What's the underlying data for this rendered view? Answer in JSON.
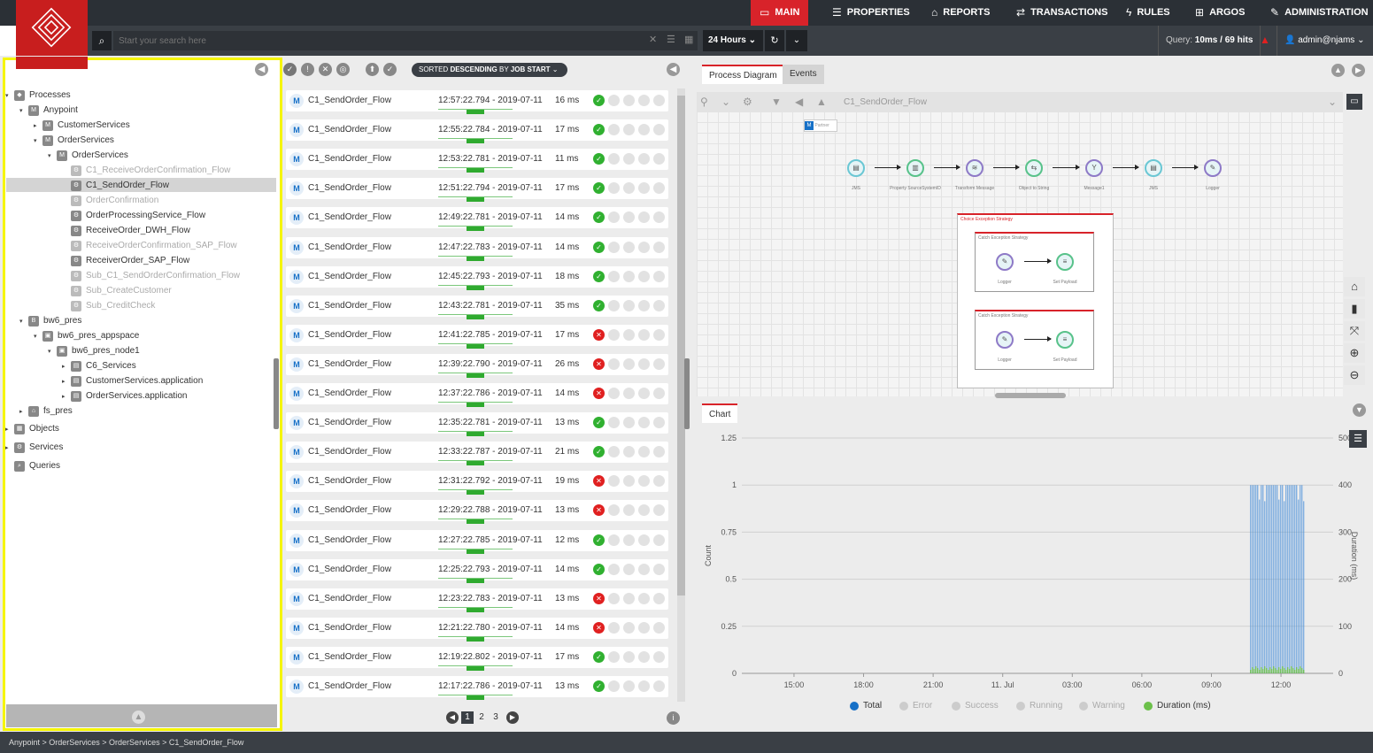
{
  "nav": {
    "items": [
      {
        "label": "MAIN",
        "icon": "dashboard-icon",
        "glyph": "▭"
      },
      {
        "label": "PROPERTIES",
        "icon": "list-icon",
        "glyph": "☰"
      },
      {
        "label": "REPORTS",
        "icon": "chart-icon",
        "glyph": "⌂"
      },
      {
        "label": "TRANSACTIONS",
        "icon": "exchange-icon",
        "glyph": "⇄"
      },
      {
        "label": "RULES",
        "icon": "bolt-icon",
        "glyph": "ϟ"
      },
      {
        "label": "ARGOS",
        "icon": "argos-icon",
        "glyph": "⊞"
      },
      {
        "label": "ADMINISTRATION",
        "icon": "wrench-icon",
        "glyph": "✎"
      }
    ],
    "active": "MAIN",
    "active_color": "#d8232a"
  },
  "search": {
    "placeholder": "Start your search here"
  },
  "time": {
    "range": "24 Hours"
  },
  "query": {
    "label": "Query:",
    "value": "10ms / 69 hits"
  },
  "user": {
    "name": "admin@njams"
  },
  "tree": [
    {
      "label": "Processes",
      "icon": "processes-icon"
    },
    {
      "label": "Anypoint",
      "icon": "mule-domain-icon"
    },
    {
      "label": "CustomerServices",
      "icon": "mule-app-icon"
    },
    {
      "label": "OrderServices",
      "icon": "mule-app-icon"
    },
    {
      "label": "OrderServices",
      "icon": "mule-app-icon"
    },
    {
      "label": "C1_ReceiveOrderConfirmation_Flow",
      "icon": "flow-icon"
    },
    {
      "label": "C1_SendOrder_Flow",
      "icon": "flow-icon"
    },
    {
      "label": "OrderConfirmation",
      "icon": "flow-icon"
    },
    {
      "label": "OrderProcessingService_Flow",
      "icon": "flow-icon"
    },
    {
      "label": "ReceiveOrder_DWH_Flow",
      "icon": "flow-icon"
    },
    {
      "label": "ReceiveOrderConfirmation_SAP_Flow",
      "icon": "flow-icon"
    },
    {
      "label": "ReceiverOrder_SAP_Flow",
      "icon": "flow-icon"
    },
    {
      "label": "Sub_C1_SendOrderConfirmation_Flow",
      "icon": "flow-icon"
    },
    {
      "label": "Sub_CreateCustomer",
      "icon": "flow-icon"
    },
    {
      "label": "Sub_CreditCheck",
      "icon": "flow-icon"
    },
    {
      "label": "bw6_pres",
      "icon": "bw-domain-icon"
    },
    {
      "label": "bw6_pres_appspace",
      "icon": "appspace-icon"
    },
    {
      "label": "bw6_pres_node1",
      "icon": "appnode-icon"
    },
    {
      "label": "C6_Services",
      "icon": "application-icon"
    },
    {
      "label": "CustomerServices.application",
      "icon": "application-icon"
    },
    {
      "label": "OrderServices.application",
      "icon": "application-icon"
    },
    {
      "label": "fs_pres",
      "icon": "home-icon"
    },
    {
      "label": "Objects",
      "icon": "objects-icon"
    },
    {
      "label": "Services",
      "icon": "services-icon"
    },
    {
      "label": "Queries",
      "icon": "search-icon"
    }
  ],
  "sort": {
    "prefix": "SORTED",
    "order": "DESCENDING",
    "by": "BY",
    "field": "JOB START"
  },
  "executions": [
    {
      "name": "C1_SendOrder_Flow",
      "time": "12:57:22.794 - 2019-07-11",
      "duration": "16 ms",
      "status": "success"
    },
    {
      "name": "C1_SendOrder_Flow",
      "time": "12:55:22.784 - 2019-07-11",
      "duration": "17 ms",
      "status": "success"
    },
    {
      "name": "C1_SendOrder_Flow",
      "time": "12:53:22.781 - 2019-07-11",
      "duration": "11 ms",
      "status": "success"
    },
    {
      "name": "C1_SendOrder_Flow",
      "time": "12:51:22.794 - 2019-07-11",
      "duration": "17 ms",
      "status": "success"
    },
    {
      "name": "C1_SendOrder_Flow",
      "time": "12:49:22.781 - 2019-07-11",
      "duration": "14 ms",
      "status": "success"
    },
    {
      "name": "C1_SendOrder_Flow",
      "time": "12:47:22.783 - 2019-07-11",
      "duration": "14 ms",
      "status": "success"
    },
    {
      "name": "C1_SendOrder_Flow",
      "time": "12:45:22.793 - 2019-07-11",
      "duration": "18 ms",
      "status": "success"
    },
    {
      "name": "C1_SendOrder_Flow",
      "time": "12:43:22.781 - 2019-07-11",
      "duration": "35 ms",
      "status": "success"
    },
    {
      "name": "C1_SendOrder_Flow",
      "time": "12:41:22.785 - 2019-07-11",
      "duration": "17 ms",
      "status": "error"
    },
    {
      "name": "C1_SendOrder_Flow",
      "time": "12:39:22.790 - 2019-07-11",
      "duration": "26 ms",
      "status": "error"
    },
    {
      "name": "C1_SendOrder_Flow",
      "time": "12:37:22.786 - 2019-07-11",
      "duration": "14 ms",
      "status": "error"
    },
    {
      "name": "C1_SendOrder_Flow",
      "time": "12:35:22.781 - 2019-07-11",
      "duration": "13 ms",
      "status": "success"
    },
    {
      "name": "C1_SendOrder_Flow",
      "time": "12:33:22.787 - 2019-07-11",
      "duration": "21 ms",
      "status": "success"
    },
    {
      "name": "C1_SendOrder_Flow",
      "time": "12:31:22.792 - 2019-07-11",
      "duration": "19 ms",
      "status": "error"
    },
    {
      "name": "C1_SendOrder_Flow",
      "time": "12:29:22.788 - 2019-07-11",
      "duration": "13 ms",
      "status": "error"
    },
    {
      "name": "C1_SendOrder_Flow",
      "time": "12:27:22.785 - 2019-07-11",
      "duration": "12 ms",
      "status": "success"
    },
    {
      "name": "C1_SendOrder_Flow",
      "time": "12:25:22.793 - 2019-07-11",
      "duration": "14 ms",
      "status": "success"
    },
    {
      "name": "C1_SendOrder_Flow",
      "time": "12:23:22.783 - 2019-07-11",
      "duration": "13 ms",
      "status": "error"
    },
    {
      "name": "C1_SendOrder_Flow",
      "time": "12:21:22.780 - 2019-07-11",
      "duration": "14 ms",
      "status": "error"
    },
    {
      "name": "C1_SendOrder_Flow",
      "time": "12:19:22.802 - 2019-07-11",
      "duration": "17 ms",
      "status": "success"
    },
    {
      "name": "C1_SendOrder_Flow",
      "time": "12:17:22.786 - 2019-07-11",
      "duration": "13 ms",
      "status": "success"
    }
  ],
  "pagination": {
    "pages": [
      "1",
      "2",
      "3"
    ],
    "current": "1"
  },
  "tabs": {
    "diagram": "Process Diagram",
    "events": "Events",
    "chart": "Chart"
  },
  "diagram": {
    "title": "C1_SendOrder_Flow",
    "badge": "Partner",
    "nodes": [
      "JMS",
      "Property SourceSystemID",
      "Transform Message",
      "Object to String",
      "Message1",
      "JMS",
      "Logger"
    ],
    "exception_outer": "Choice Exception Strategy",
    "exception_blocks": [
      {
        "title": "Catch Exception Strategy",
        "nodes": [
          "Logger",
          "Set Payload"
        ]
      },
      {
        "title": "Catch Exception Strategy",
        "nodes": [
          "Logger",
          "Set Payload"
        ]
      }
    ]
  },
  "chart_data": {
    "type": "bar",
    "ylabel": "Count",
    "y2label": "Duration (ms)",
    "ylim": [
      0,
      1.25
    ],
    "y2lim": [
      0,
      500
    ],
    "yticks": [
      "0",
      "0.25",
      "0.5",
      "0.75",
      "1",
      "1.25"
    ],
    "y2ticks": [
      "0",
      "100",
      "200",
      "300",
      "400",
      "500"
    ],
    "xticks": [
      "15:00",
      "18:00",
      "21:00",
      "11. Jul",
      "03:00",
      "06:00",
      "09:00",
      "12:00"
    ],
    "grid": true,
    "legend_position": "bottom",
    "series": [
      {
        "name": "Total",
        "color": "#1670c7",
        "enabled": true
      },
      {
        "name": "Error",
        "color": "#cccccc",
        "enabled": false
      },
      {
        "name": "Success",
        "color": "#cccccc",
        "enabled": false
      },
      {
        "name": "Running",
        "color": "#cccccc",
        "enabled": false
      },
      {
        "name": "Warning",
        "color": "#cccccc",
        "enabled": false
      },
      {
        "name": "Duration (ms)",
        "color": "#6cc04a",
        "enabled": true
      }
    ],
    "total_count_window": {
      "x_start": "10:40",
      "x_end": "13:00",
      "value": 1
    }
  },
  "breadcrumb": "Anypoint > OrderServices > OrderServices > C1_SendOrder_Flow"
}
